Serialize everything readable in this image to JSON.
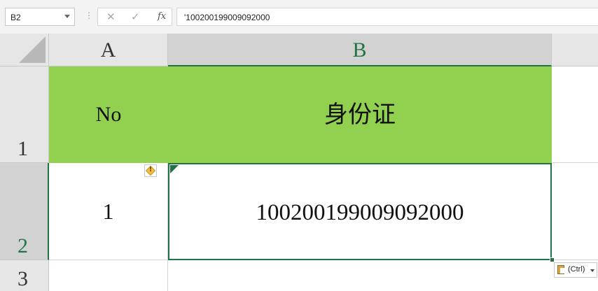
{
  "formula_bar": {
    "name_box": "B2",
    "cancel_glyph": "✕",
    "enter_glyph": "✓",
    "fx_label": "fx",
    "formula": "'100200199009092000"
  },
  "columns": [
    "A",
    "B"
  ],
  "rows": [
    "1",
    "2",
    "3"
  ],
  "cells": {
    "A1": "No",
    "B1": "身份证",
    "A2": "1",
    "B2": "100200199009092000"
  },
  "paste_options": {
    "label": "(Ctrl)"
  },
  "colors": {
    "header_fill": "#92d050",
    "selection": "#217346"
  },
  "icons": {
    "error_indicator": "warning-icon",
    "paste": "clipboard-icon"
  }
}
